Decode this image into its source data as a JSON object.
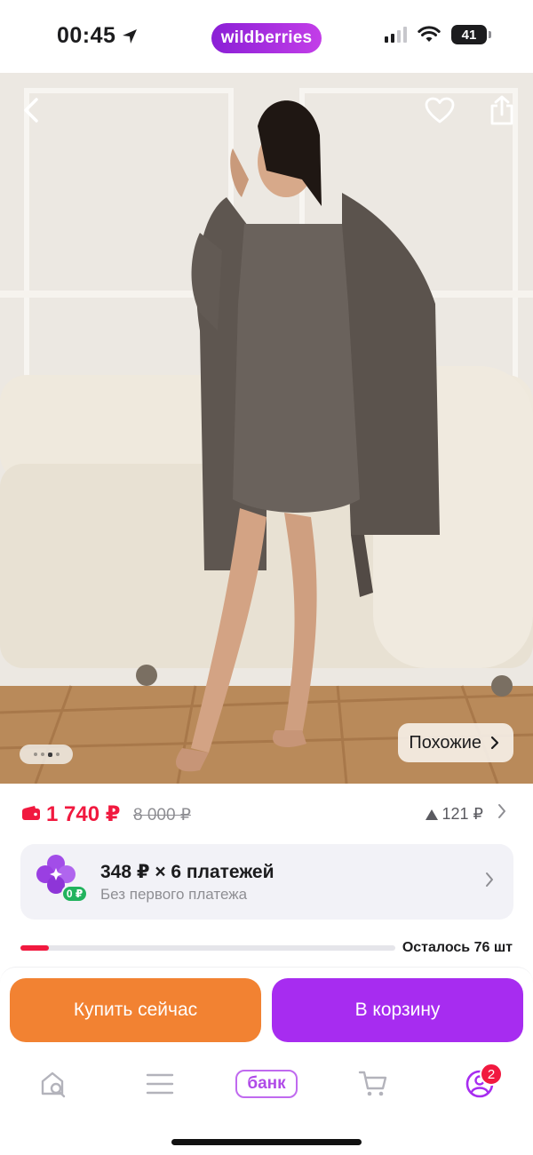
{
  "status_bar": {
    "time": "00:45",
    "brand": "wildberries",
    "battery": "41"
  },
  "hero": {
    "similar_label": "Похожие",
    "gallery_total": 4,
    "gallery_current": 3
  },
  "price": {
    "current": "1 740 ₽",
    "old": "8 000 ₽",
    "diff": "121 ₽"
  },
  "installments": {
    "title": "348 ₽ × 6 платежей",
    "subtitle": "Без первого платежа",
    "badge": "0 ₽"
  },
  "stock": {
    "label": "Осталось 76 шт",
    "fill_fraction": 0.075
  },
  "actions": {
    "buy_now": "Купить сейчас",
    "add_to_cart": "В корзину"
  },
  "tabbar": {
    "bank_label": "банк",
    "profile_badge": "2"
  },
  "colors": {
    "price_red": "#f1193f",
    "buy_orange": "#f28232",
    "cart_purple": "#a72cf0",
    "brand_purple": "#9b2ae0",
    "zero_badge_green": "#22b35e"
  },
  "icons": [
    "location-arrow-icon",
    "signal-icon",
    "wifi-icon",
    "battery-icon",
    "back-arrow-icon",
    "heart-icon",
    "share-icon",
    "chevron-right-icon",
    "wallet-icon",
    "triangle-up-icon",
    "clover-installment-icon",
    "home-search-icon",
    "menu-icon",
    "cart-icon",
    "profile-icon"
  ]
}
